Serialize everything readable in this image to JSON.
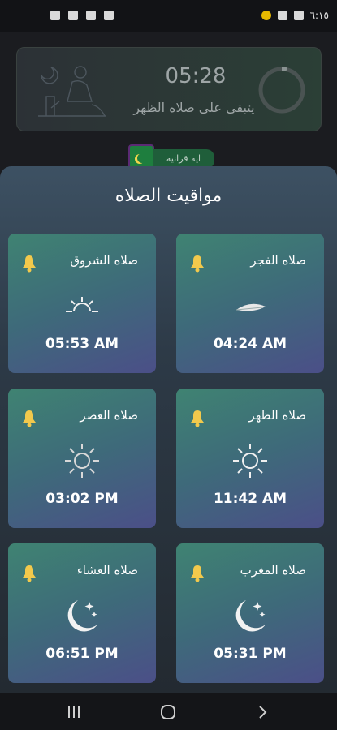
{
  "status_bar": {
    "time": "٦:١٥"
  },
  "next_prayer": {
    "countdown": "05:28",
    "remaining_text": "يتبقى على صلاه الظهر"
  },
  "verse_button": {
    "label": "ايه قرانيه"
  },
  "sheet": {
    "title": "مواقيت الصلاه"
  },
  "prayers": [
    {
      "name": "صلاه الفجر",
      "time": "04:24 AM",
      "icon": "feather-icon"
    },
    {
      "name": "صلاه الشروق",
      "time": "05:53 AM",
      "icon": "sunrise-icon"
    },
    {
      "name": "صلاه الظهر",
      "time": "11:42 AM",
      "icon": "sun-icon"
    },
    {
      "name": "صلاه العصر",
      "time": "03:02 PM",
      "icon": "sun-icon"
    },
    {
      "name": "صلاه المغرب",
      "time": "05:31 PM",
      "icon": "moon-stars-icon"
    },
    {
      "name": "صلاه العشاء",
      "time": "06:51 PM",
      "icon": "moon-stars-icon"
    }
  ],
  "colors": {
    "bell": "#f2c94c",
    "card_top": "#3f8372",
    "card_bottom": "#4b4f88"
  }
}
